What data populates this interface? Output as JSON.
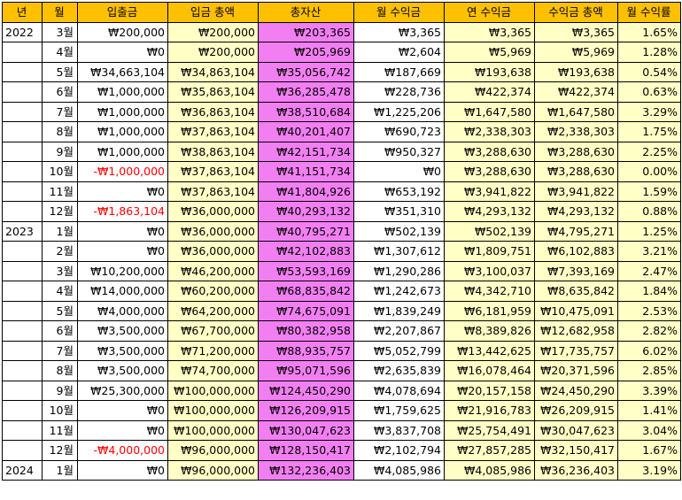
{
  "headers": [
    "년",
    "월",
    "입출금",
    "입금 총액",
    "총자산",
    "월 수익금",
    "연 수익금",
    "수익금 총액",
    "월 수익률"
  ],
  "rows": [
    {
      "year": "2022",
      "month": "3월",
      "deposit": "₩200,000",
      "neg": false,
      "cum": "₩200,000",
      "total": "₩203,365",
      "mret": "₩3,365",
      "yret": "₩3,365",
      "tret": "₩3,365",
      "rate": "1.65%"
    },
    {
      "year": "",
      "month": "4월",
      "deposit": "₩0",
      "neg": false,
      "cum": "₩200,000",
      "total": "₩205,969",
      "mret": "₩2,604",
      "yret": "₩5,969",
      "tret": "₩5,969",
      "rate": "1.28%"
    },
    {
      "year": "",
      "month": "5월",
      "deposit": "₩34,663,104",
      "neg": false,
      "cum": "₩34,863,104",
      "total": "₩35,056,742",
      "mret": "₩187,669",
      "yret": "₩193,638",
      "tret": "₩193,638",
      "rate": "0.54%"
    },
    {
      "year": "",
      "month": "6월",
      "deposit": "₩1,000,000",
      "neg": false,
      "cum": "₩35,863,104",
      "total": "₩36,285,478",
      "mret": "₩228,736",
      "yret": "₩422,374",
      "tret": "₩422,374",
      "rate": "0.63%"
    },
    {
      "year": "",
      "month": "7월",
      "deposit": "₩1,000,000",
      "neg": false,
      "cum": "₩36,863,104",
      "total": "₩38,510,684",
      "mret": "₩1,225,206",
      "yret": "₩1,647,580",
      "tret": "₩1,647,580",
      "rate": "3.29%"
    },
    {
      "year": "",
      "month": "8월",
      "deposit": "₩1,000,000",
      "neg": false,
      "cum": "₩37,863,104",
      "total": "₩40,201,407",
      "mret": "₩690,723",
      "yret": "₩2,338,303",
      "tret": "₩2,338,303",
      "rate": "1.75%"
    },
    {
      "year": "",
      "month": "9월",
      "deposit": "₩1,000,000",
      "neg": false,
      "cum": "₩38,863,104",
      "total": "₩42,151,734",
      "mret": "₩950,327",
      "yret": "₩3,288,630",
      "tret": "₩3,288,630",
      "rate": "2.25%"
    },
    {
      "year": "",
      "month": "10월",
      "deposit": "-₩1,000,000",
      "neg": true,
      "cum": "₩37,863,104",
      "total": "₩41,151,734",
      "mret": "₩0",
      "yret": "₩3,288,630",
      "tret": "₩3,288,630",
      "rate": "0.00%"
    },
    {
      "year": "",
      "month": "11월",
      "deposit": "₩0",
      "neg": false,
      "cum": "₩37,863,104",
      "total": "₩41,804,926",
      "mret": "₩653,192",
      "yret": "₩3,941,822",
      "tret": "₩3,941,822",
      "rate": "1.59%"
    },
    {
      "year": "",
      "month": "12월",
      "deposit": "-₩1,863,104",
      "neg": true,
      "cum": "₩36,000,000",
      "total": "₩40,293,132",
      "mret": "₩351,310",
      "yret": "₩4,293,132",
      "tret": "₩4,293,132",
      "rate": "0.88%"
    },
    {
      "year": "2023",
      "month": "1월",
      "deposit": "₩0",
      "neg": false,
      "cum": "₩36,000,000",
      "total": "₩40,795,271",
      "mret": "₩502,139",
      "yret": "₩502,139",
      "tret": "₩4,795,271",
      "rate": "1.25%"
    },
    {
      "year": "",
      "month": "2월",
      "deposit": "₩0",
      "neg": false,
      "cum": "₩36,000,000",
      "total": "₩42,102,883",
      "mret": "₩1,307,612",
      "yret": "₩1,809,751",
      "tret": "₩6,102,883",
      "rate": "3.21%"
    },
    {
      "year": "",
      "month": "3월",
      "deposit": "₩10,200,000",
      "neg": false,
      "cum": "₩46,200,000",
      "total": "₩53,593,169",
      "mret": "₩1,290,286",
      "yret": "₩3,100,037",
      "tret": "₩7,393,169",
      "rate": "2.47%"
    },
    {
      "year": "",
      "month": "4월",
      "deposit": "₩14,000,000",
      "neg": false,
      "cum": "₩60,200,000",
      "total": "₩68,835,842",
      "mret": "₩1,242,673",
      "yret": "₩4,342,710",
      "tret": "₩8,635,842",
      "rate": "1.84%"
    },
    {
      "year": "",
      "month": "5월",
      "deposit": "₩4,000,000",
      "neg": false,
      "cum": "₩64,200,000",
      "total": "₩74,675,091",
      "mret": "₩1,839,249",
      "yret": "₩6,181,959",
      "tret": "₩10,475,091",
      "rate": "2.53%"
    },
    {
      "year": "",
      "month": "6월",
      "deposit": "₩3,500,000",
      "neg": false,
      "cum": "₩67,700,000",
      "total": "₩80,382,958",
      "mret": "₩2,207,867",
      "yret": "₩8,389,826",
      "tret": "₩12,682,958",
      "rate": "2.82%"
    },
    {
      "year": "",
      "month": "7월",
      "deposit": "₩3,500,000",
      "neg": false,
      "cum": "₩71,200,000",
      "total": "₩88,935,757",
      "mret": "₩5,052,799",
      "yret": "₩13,442,625",
      "tret": "₩17,735,757",
      "rate": "6.02%"
    },
    {
      "year": "",
      "month": "8월",
      "deposit": "₩3,500,000",
      "neg": false,
      "cum": "₩74,700,000",
      "total": "₩95,071,596",
      "mret": "₩2,635,839",
      "yret": "₩16,078,464",
      "tret": "₩20,371,596",
      "rate": "2.85%"
    },
    {
      "year": "",
      "month": "9월",
      "deposit": "₩25,300,000",
      "neg": false,
      "cum": "₩100,000,000",
      "total": "₩124,450,290",
      "mret": "₩4,078,694",
      "yret": "₩20,157,158",
      "tret": "₩24,450,290",
      "rate": "3.39%"
    },
    {
      "year": "",
      "month": "10월",
      "deposit": "₩0",
      "neg": false,
      "cum": "₩100,000,000",
      "total": "₩126,209,915",
      "mret": "₩1,759,625",
      "yret": "₩21,916,783",
      "tret": "₩26,209,915",
      "rate": "1.41%"
    },
    {
      "year": "",
      "month": "11월",
      "deposit": "₩0",
      "neg": false,
      "cum": "₩100,000,000",
      "total": "₩130,047,623",
      "mret": "₩3,837,708",
      "yret": "₩25,754,491",
      "tret": "₩30,047,623",
      "rate": "3.04%"
    },
    {
      "year": "",
      "month": "12월",
      "deposit": "-₩4,000,000",
      "neg": true,
      "cum": "₩96,000,000",
      "total": "₩128,150,417",
      "mret": "₩2,102,794",
      "yret": "₩27,857,285",
      "tret": "₩32,150,417",
      "rate": "1.67%"
    },
    {
      "year": "2024",
      "month": "1월",
      "deposit": "₩0",
      "neg": false,
      "cum": "₩96,000,000",
      "total": "₩132,236,403",
      "mret": "₩4,085,986",
      "yret": "₩4,085,986",
      "tret": "₩36,236,403",
      "rate": "3.19%"
    }
  ],
  "colors": {
    "header_bg": "#ffc000",
    "highlight_bg": "#ffffc6",
    "total_bg": "#f27ff2",
    "negative_text": "#ff0000"
  }
}
